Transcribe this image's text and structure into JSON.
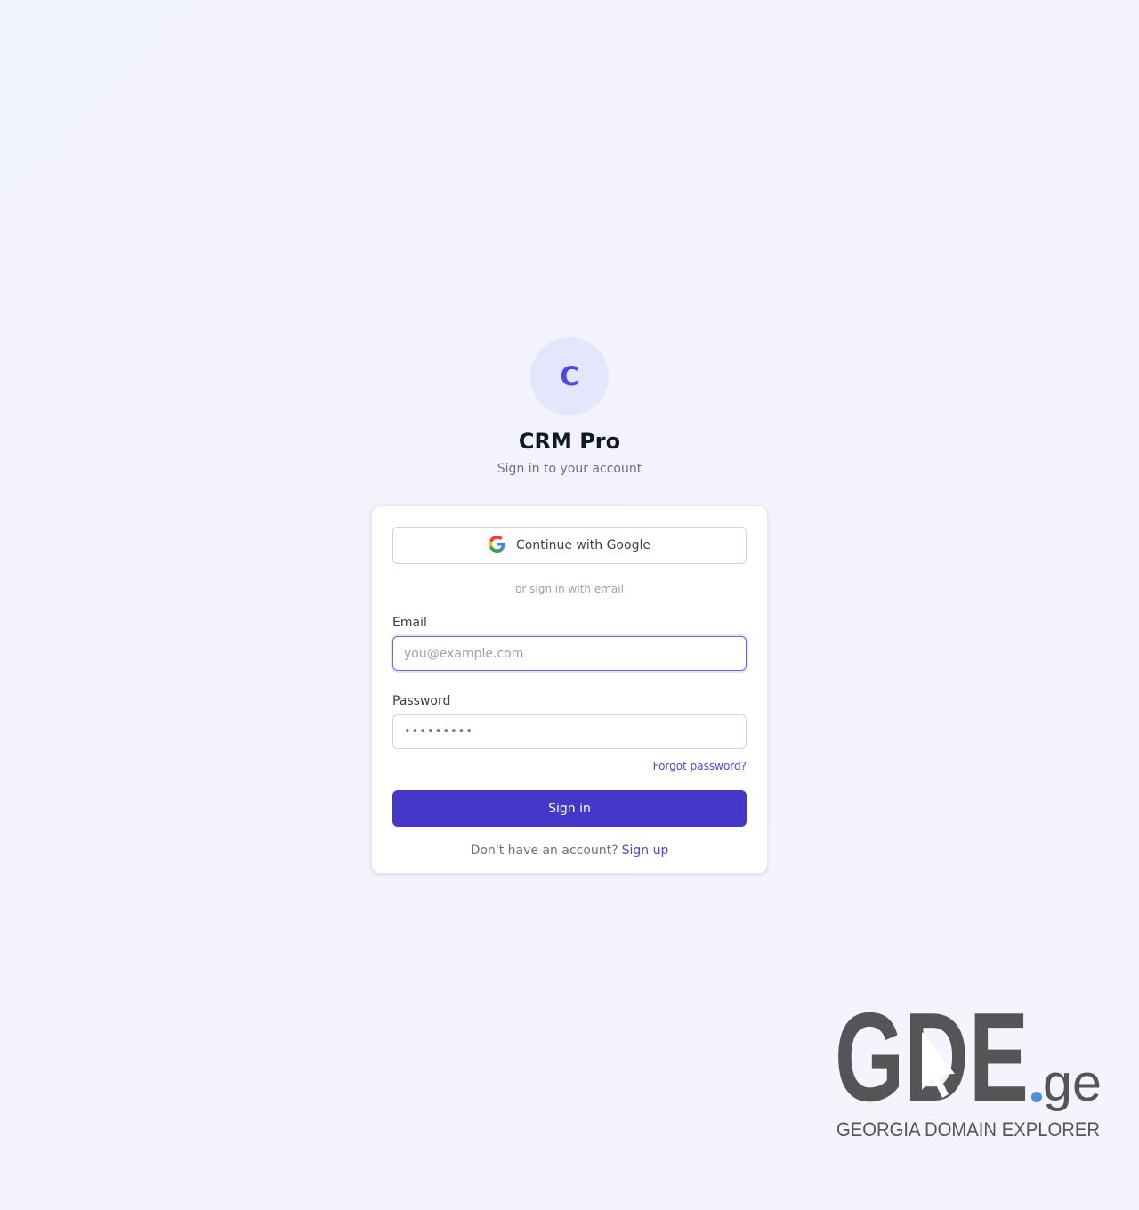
{
  "app": {
    "logo_letter": "C",
    "title": "CRM Pro",
    "subtitle": "Sign in to your account"
  },
  "login": {
    "google_button_label": "Continue with Google",
    "divider_text": "or sign in with email",
    "email_label": "Email",
    "email_placeholder": "you@example.com",
    "email_value": "",
    "password_label": "Password",
    "password_value_masked": "•••••••••",
    "forgot_password_label": "Forgot password?",
    "signin_button_label": "Sign in",
    "signup_prompt": "Don't have an account?",
    "signup_link_label": "Sign up"
  },
  "watermark": {
    "brand": "GDE.ge",
    "tagline": "GEORGIA DOMAIN EXPLORER"
  },
  "colors": {
    "accent": "#4f46e5",
    "primary_button": "#4338ca",
    "logo_bg": "#e3e6fc",
    "watermark_gray": "#555558",
    "watermark_dot": "#4a90e2"
  },
  "icons": {
    "google": "google-icon"
  }
}
